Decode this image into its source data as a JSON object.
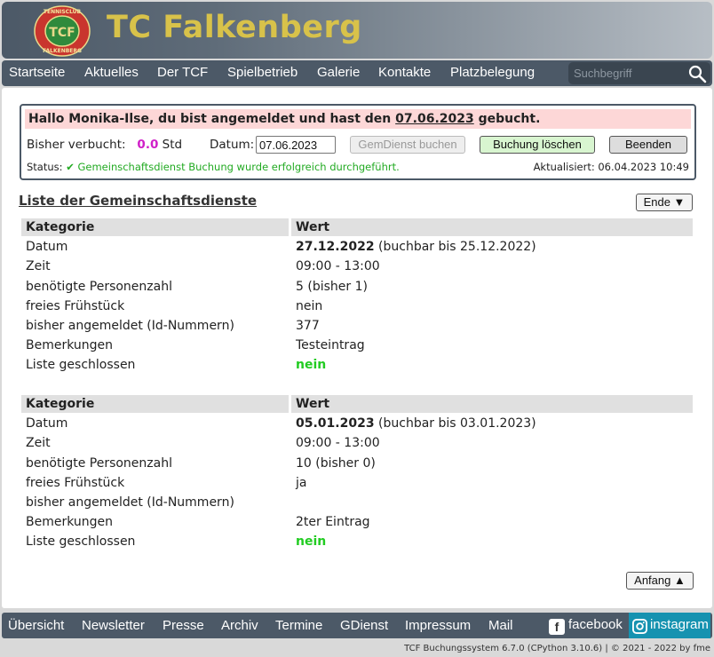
{
  "header": {
    "title": "TC Falkenberg",
    "logo_text_top": "TENNISCLUB",
    "logo_text_bottom": "FALKENBERG",
    "logo_initials": "TCF"
  },
  "nav": {
    "items": [
      "Startseite",
      "Aktuelles",
      "Der TCF",
      "Spielbetrieb",
      "Galerie",
      "Kontakte",
      "Platzbelegung"
    ],
    "search_placeholder": "Suchbegriff"
  },
  "booking": {
    "greeting_pre": "Hallo Monika-Ilse, du bist angemeldet und hast den ",
    "greeting_date": "07.06.2023",
    "greeting_post": " gebucht.",
    "booked_label": "Bisher verbucht:",
    "booked_hours": "0.0",
    "booked_unit": "Std",
    "date_label": "Datum:",
    "date_value": "07.06.2023",
    "btn_book": "GemDienst buchen",
    "btn_delete": "Buchung löschen",
    "btn_end": "Beenden",
    "status_label": "Status:",
    "status_msg": "✔ Gemeinschaftsdienst Buchung wurde erfolgreich durchgeführt.",
    "updated": "Aktualisiert: 06.04.2023 10:49"
  },
  "list": {
    "title": "Liste der Gemeinschaftsdienste",
    "btn_end": "Ende ▼",
    "btn_start": "Anfang ▲",
    "head_key": "Kategorie",
    "head_value": "Wert",
    "keys": [
      "Datum",
      "Zeit",
      "benötigte Personenzahl",
      "freies Frühstück",
      "bisher angemeldet (Id-Nummern)",
      "Bemerkungen",
      "Liste geschlossen"
    ],
    "entries": [
      {
        "date": "27.12.2022",
        "bookable": "(buchbar bis 25.12.2022)",
        "time": "09:00 - 13:00",
        "persons": "5 (bisher 1)",
        "breakfast": "nein",
        "registered": "377",
        "remarks": "Testeintrag",
        "closed": "nein"
      },
      {
        "date": "05.01.2023",
        "bookable": "(buchbar bis 03.01.2023)",
        "time": "09:00 - 13:00",
        "persons": "10 (bisher 0)",
        "breakfast": "ja",
        "registered": "",
        "remarks": "2ter Eintrag",
        "closed": "nein"
      }
    ]
  },
  "footer": {
    "items": [
      "Übersicht",
      "Newsletter",
      "Presse",
      "Archiv",
      "Termine",
      "GDienst",
      "Impressum",
      "Mail"
    ],
    "facebook": "facebook",
    "instagram": "instagram",
    "copyright": "TCF Buchungssystem 6.7.0 (CPython 3.10.6)  |  © 2021 - 2022 by fme"
  },
  "colors": {
    "nav_bg": "#4c5967",
    "title": "#d8c24a",
    "greeting_bg": "#fdd7d7",
    "hours": "#d020c8",
    "success": "#22aa22",
    "instagram_bg": "#1692b0"
  }
}
